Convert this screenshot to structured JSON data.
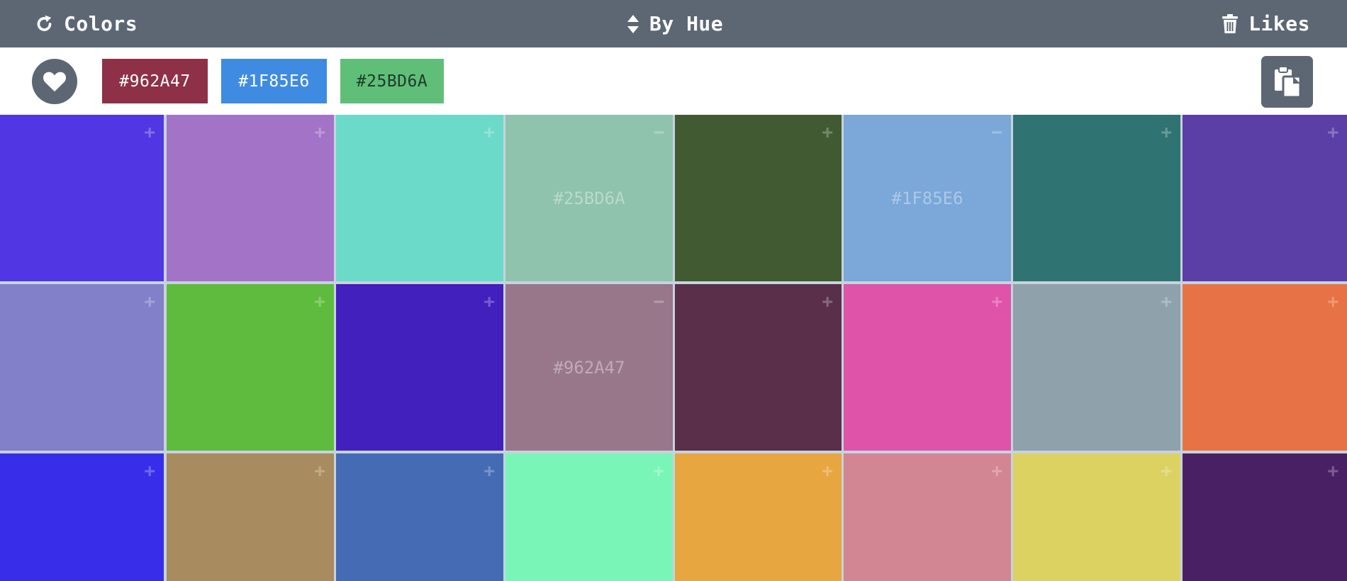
{
  "topbar": {
    "colors_label": "Colors",
    "sort_label": "By Hue",
    "likes_label": "Likes"
  },
  "likes": [
    {
      "hex": "#962A47",
      "bg": "#8e3048",
      "fg": "#ffffff"
    },
    {
      "hex": "#1F85E6",
      "bg": "#3f8be2",
      "fg": "#ffffff"
    },
    {
      "hex": "#25BD6A",
      "bg": "#5fbf78",
      "fg": "#1f3b2a"
    }
  ],
  "grid": {
    "rows": [
      [
        {
          "color": "#5037e3",
          "sign": "+"
        },
        {
          "color": "#a373c8",
          "sign": "+"
        },
        {
          "color": "#6bdac8",
          "sign": "+"
        },
        {
          "color": "#8fc3ad",
          "sign": "−",
          "label": "#25BD6A"
        },
        {
          "color": "#415a32",
          "sign": "+"
        },
        {
          "color": "#7ba7d9",
          "sign": "−",
          "label": "#1F85E6"
        },
        {
          "color": "#2f7372",
          "sign": "+"
        },
        {
          "color": "#5b3fa7",
          "sign": "+"
        }
      ],
      [
        {
          "color": "#8180c9",
          "sign": "+"
        },
        {
          "color": "#5fbb3e",
          "sign": "+"
        },
        {
          "color": "#4120bd",
          "sign": "+"
        },
        {
          "color": "#98778b",
          "sign": "−",
          "label": "#962A47"
        },
        {
          "color": "#5a2f4a",
          "sign": "+"
        },
        {
          "color": "#df53a9",
          "sign": "+"
        },
        {
          "color": "#8fa1aa",
          "sign": "+"
        },
        {
          "color": "#e77245",
          "sign": "+"
        }
      ],
      [
        {
          "color": "#382eea",
          "sign": "+"
        },
        {
          "color": "#a88b5e",
          "sign": "+"
        },
        {
          "color": "#446bb4",
          "sign": "+"
        },
        {
          "color": "#79f5b8",
          "sign": "+"
        },
        {
          "color": "#e8a641",
          "sign": "+"
        },
        {
          "color": "#d28592",
          "sign": "+"
        },
        {
          "color": "#dbd262",
          "sign": "+"
        },
        {
          "color": "#4a2064",
          "sign": "+"
        }
      ]
    ]
  },
  "icons": {
    "refresh": "refresh-icon",
    "sort": "sort-icon",
    "trash": "trash-icon",
    "heart": "heart-icon",
    "copy": "clipboard-icon"
  }
}
